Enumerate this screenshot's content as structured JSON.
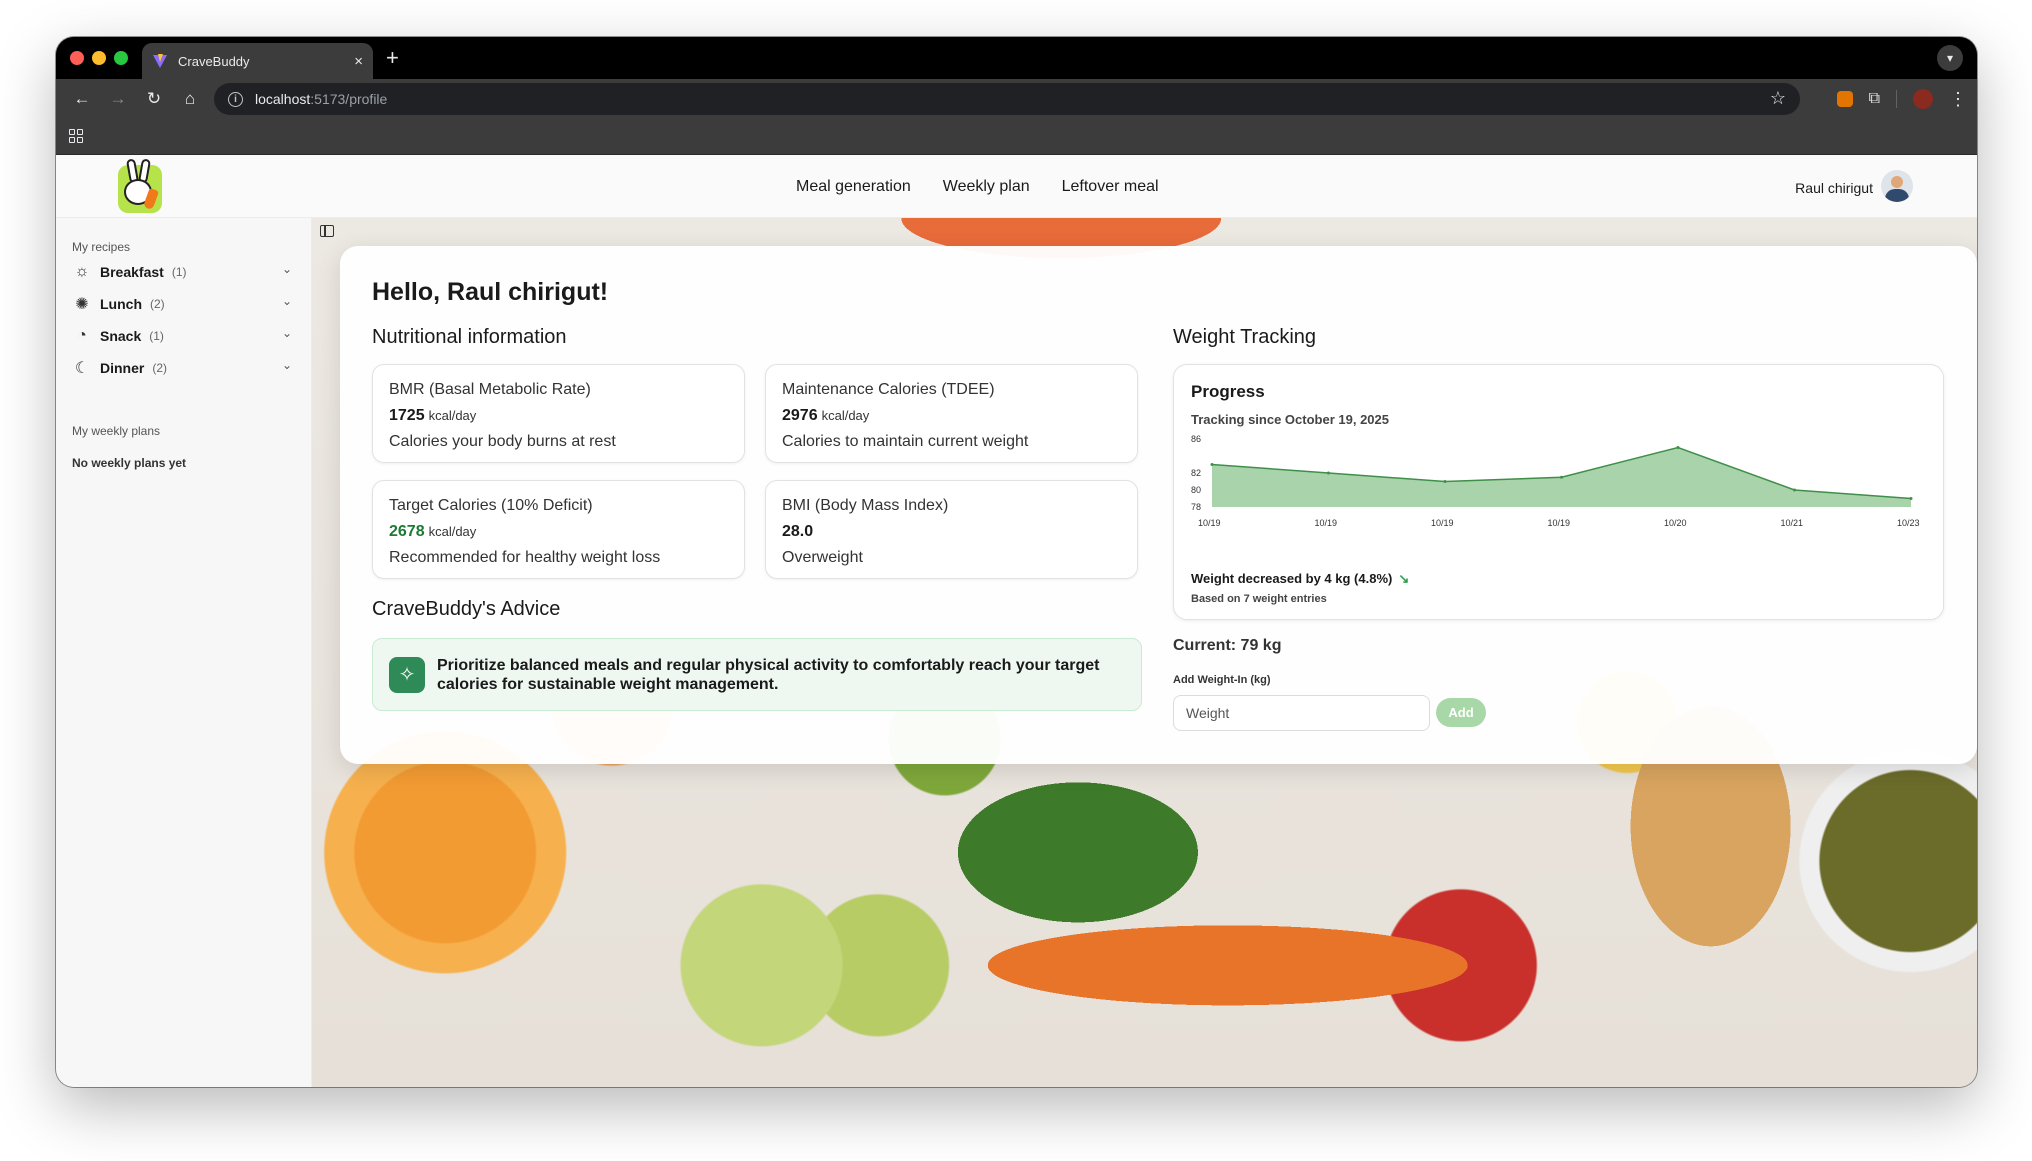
{
  "browser": {
    "tab_title": "CraveBuddy",
    "tab_close": "×",
    "new_tab": "+",
    "url_host": "localhost",
    "url_path": ":5173/profile"
  },
  "navbar": {
    "links": [
      "Meal generation",
      "Weekly plan",
      "Leftover meal"
    ],
    "user_name": "Raul chirigut"
  },
  "sidebar": {
    "recipes_heading": "My recipes",
    "recipes": [
      {
        "label": "Breakfast",
        "count": "(1)",
        "icon": "sunrise-icon"
      },
      {
        "label": "Lunch",
        "count": "(2)",
        "icon": "sun-icon"
      },
      {
        "label": "Snack",
        "count": "(1)",
        "icon": "cookie-icon"
      },
      {
        "label": "Dinner",
        "count": "(2)",
        "icon": "moon-icon"
      }
    ],
    "weekly_heading": "My weekly plans",
    "weekly_empty": "No weekly plans yet"
  },
  "profile": {
    "greeting": "Hello, Raul chirigut!",
    "nutrition_title": "Nutritional information",
    "stats": [
      {
        "title": "BMR (Basal Metabolic Rate)",
        "value": "1725",
        "unit": "kcal/day",
        "desc": "Calories your body burns at rest"
      },
      {
        "title": "Maintenance Calories (TDEE)",
        "value": "2976",
        "unit": "kcal/day",
        "desc": "Calories to maintain current weight"
      },
      {
        "title": "Target Calories (10% Deficit)",
        "value": "2678",
        "unit": "kcal/day",
        "desc": "Recommended for healthy weight loss"
      },
      {
        "title": "BMI (Body Mass Index)",
        "value": "28.0",
        "unit": "",
        "desc": "Overweight"
      }
    ],
    "advice_title": "CraveBuddy's Advice",
    "advice_text": "Prioritize balanced meals and regular physical activity to comfortably reach your target calories for sustainable weight management.",
    "accent_green": "#1d7a33"
  },
  "weight": {
    "title": "Weight Tracking",
    "progress_title": "Progress",
    "tracking_since": "Tracking since October 19, 2025",
    "delta_text": "Weight decreased by 4 kg (4.8%)",
    "based_on": "Based on 7 weight entries",
    "current": "Current: 79 kg",
    "add_label": "Add Weight-In (kg)",
    "input_placeholder": "Weight",
    "add_button": "Add"
  },
  "chart_data": {
    "type": "area",
    "title": "Progress",
    "categories": [
      "10/19",
      "10/19",
      "10/19",
      "10/19",
      "10/20",
      "10/21",
      "10/23"
    ],
    "series": [
      {
        "values": [
          83,
          82,
          81,
          81.5,
          85,
          80,
          79
        ]
      }
    ],
    "y_ticks": [
      78,
      80,
      82,
      86
    ],
    "ylim": [
      78,
      86
    ],
    "fill_color": "#a9d3ab",
    "line_color": "#3f8f4a",
    "grid": false
  }
}
